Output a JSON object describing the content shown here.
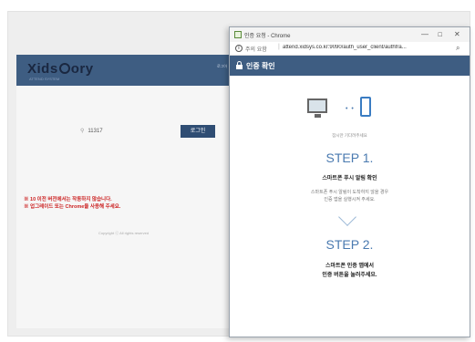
{
  "login_page": {
    "logo_text_left": "Xids",
    "logo_text_right": "ory",
    "logo_sub": "ATTEND SYSTEM",
    "header_small": "로그아",
    "id_value": "11317",
    "login_button": "로그인",
    "warning_line1": "※ 10 이전 버전에서는 작동하지 않습니다.",
    "warning_line2": "※ 업그레이드 또는 Chrome을 사용해 주세요.",
    "copyright": "Copyright ⓒ All rights reserved"
  },
  "popup": {
    "window_title": "인증 요청 - Chrome",
    "controls": {
      "minimize": "—",
      "maximize": "☐",
      "close": "✕"
    },
    "address_warning": "주의 요함",
    "address_url": "attend.xidsys.co.kr:9090/auth_user_client/authfra...",
    "auth_title": "인증 확인",
    "devices_caption": "잠시만 기다려주세요",
    "step1": {
      "title": "STEP 1.",
      "subtitle": "스마트폰 푸시 알림 확인",
      "desc_line1": "스마트폰 푸시 알림이 도착하지 않을 경우",
      "desc_line2": "인증 앱을 실행시켜 주세요."
    },
    "step2": {
      "title": "STEP 2.",
      "line1": "스마트폰 인증 앱에서",
      "line2": "인증 버튼을 눌러주세요."
    }
  },
  "icons": {
    "favicon": "chrome-page-icon",
    "info": "info-icon",
    "zoom": "zoom-icon",
    "lock": "lock-icon",
    "monitor": "monitor-icon",
    "phone": "phone-icon",
    "chevron": "chevron-down-icon",
    "user": "user-icon"
  },
  "colors": {
    "header_blue": "#3e5d82",
    "accent_blue": "#4a7ab0",
    "warning_red": "#cc2222",
    "button_blue": "#2f4d73"
  }
}
